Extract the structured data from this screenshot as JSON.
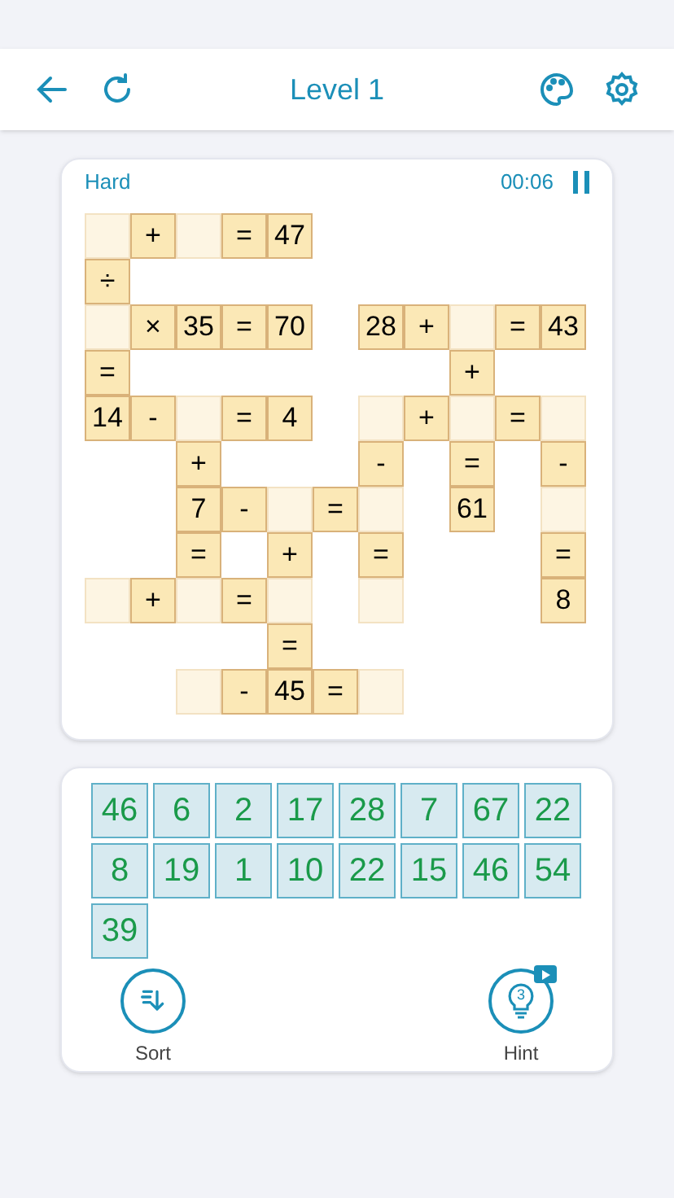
{
  "header": {
    "title": "Level 1"
  },
  "board": {
    "difficulty": "Hard",
    "timer": "00:06",
    "rows": [
      [
        {
          "kind": "blank"
        },
        {
          "kind": "given",
          "text": "+"
        },
        {
          "kind": "blank"
        },
        {
          "kind": "given",
          "text": "="
        },
        {
          "kind": "given",
          "text": "47"
        },
        null,
        null,
        null,
        null,
        null,
        null
      ],
      [
        {
          "kind": "given",
          "text": "÷"
        },
        null,
        null,
        null,
        null,
        null,
        null,
        null,
        null,
        null,
        null
      ],
      [
        {
          "kind": "blank"
        },
        {
          "kind": "given",
          "text": "×"
        },
        {
          "kind": "given",
          "text": "35"
        },
        {
          "kind": "given",
          "text": "="
        },
        {
          "kind": "given",
          "text": "70"
        },
        null,
        {
          "kind": "given",
          "text": "28"
        },
        {
          "kind": "given",
          "text": "+"
        },
        {
          "kind": "blank"
        },
        {
          "kind": "given",
          "text": "="
        },
        {
          "kind": "given",
          "text": "43"
        }
      ],
      [
        {
          "kind": "given",
          "text": "="
        },
        null,
        null,
        null,
        null,
        null,
        null,
        null,
        {
          "kind": "given",
          "text": "+"
        },
        null,
        null
      ],
      [
        {
          "kind": "given",
          "text": "14"
        },
        {
          "kind": "given",
          "text": "-"
        },
        {
          "kind": "blank"
        },
        {
          "kind": "given",
          "text": "="
        },
        {
          "kind": "given",
          "text": "4"
        },
        null,
        {
          "kind": "blank"
        },
        {
          "kind": "given",
          "text": "+"
        },
        {
          "kind": "blank"
        },
        {
          "kind": "given",
          "text": "="
        },
        {
          "kind": "blank"
        }
      ],
      [
        null,
        null,
        {
          "kind": "given",
          "text": "+"
        },
        null,
        null,
        null,
        {
          "kind": "given",
          "text": "-"
        },
        null,
        {
          "kind": "given",
          "text": "="
        },
        null,
        {
          "kind": "given",
          "text": "-"
        }
      ],
      [
        null,
        null,
        {
          "kind": "given",
          "text": "7"
        },
        {
          "kind": "given",
          "text": "-"
        },
        {
          "kind": "blank"
        },
        {
          "kind": "given",
          "text": "="
        },
        {
          "kind": "blank"
        },
        null,
        {
          "kind": "given",
          "text": "61"
        },
        null,
        {
          "kind": "blank"
        }
      ],
      [
        null,
        null,
        {
          "kind": "given",
          "text": "="
        },
        null,
        {
          "kind": "given",
          "text": "+"
        },
        null,
        {
          "kind": "given",
          "text": "="
        },
        null,
        null,
        null,
        {
          "kind": "given",
          "text": "="
        }
      ],
      [
        {
          "kind": "blank"
        },
        {
          "kind": "given",
          "text": "+"
        },
        {
          "kind": "blank"
        },
        {
          "kind": "given",
          "text": "="
        },
        {
          "kind": "blank"
        },
        null,
        {
          "kind": "blank"
        },
        null,
        null,
        null,
        {
          "kind": "given",
          "text": "8"
        }
      ],
      [
        null,
        null,
        null,
        null,
        {
          "kind": "given",
          "text": "="
        },
        null,
        null,
        null,
        null,
        null,
        null
      ],
      [
        null,
        null,
        {
          "kind": "blank"
        },
        {
          "kind": "given",
          "text": "-"
        },
        {
          "kind": "given",
          "text": "45"
        },
        {
          "kind": "given",
          "text": "="
        },
        {
          "kind": "blank"
        },
        null,
        null,
        null,
        null
      ]
    ]
  },
  "tiles": [
    "46",
    "6",
    "2",
    "17",
    "28",
    "7",
    "67",
    "22",
    "8",
    "19",
    "1",
    "10",
    "22",
    "15",
    "46",
    "54",
    "39"
  ],
  "actions": {
    "sort": {
      "label": "Sort"
    },
    "hint": {
      "label": "Hint",
      "count": "3"
    }
  }
}
